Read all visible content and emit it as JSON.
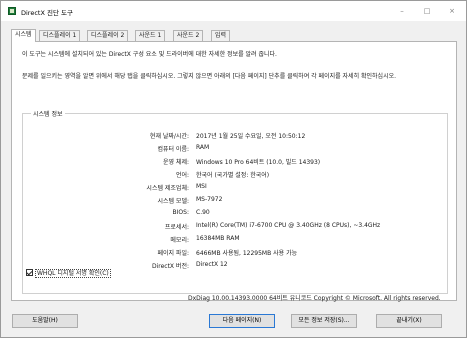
{
  "window": {
    "title": "DirectX 진단 도구",
    "minimize": "–",
    "maximize": "□",
    "close": "×"
  },
  "tabs": [
    "시스템",
    "디스플레이 1",
    "디스플레이 2",
    "사운드 1",
    "사운드 2",
    "입력"
  ],
  "intro": "이 도구는 시스템에 설치되어 있는 DirectX 구성 요소 및 드라이버에 대한 자세한 정보를 알려 줍니다.",
  "note": "문제를 일으키는 영역을 알면 위에서 해당 탭을 클릭하십시오. 그렇지 않으면 아래의 [다음 페이지] 단추를 클릭하여 각 페이지를 자세히 확인하십시오.",
  "system_info": {
    "title": "시스템 정보",
    "rows": [
      {
        "label": "현재 날짜/시간:",
        "value": "2017년 1월 25일 수요일, 오전 10:50:12"
      },
      {
        "label": "컴퓨터 이름:",
        "value": "RAM"
      },
      {
        "label": "운영 체제:",
        "value": "Windows 10 Pro 64비트 (10.0, 빌드 14393)"
      },
      {
        "label": "언어:",
        "value": "한국어 (국가별 설정: 한국어)"
      },
      {
        "label": "시스템 제조업체:",
        "value": "MSI"
      },
      {
        "label": "시스템 모델:",
        "value": "MS-7972"
      },
      {
        "label": "BIOS:",
        "value": "C.90"
      },
      {
        "label": "프로세서:",
        "value": "Intel(R) Core(TM) i7-6700 CPU @ 3.40GHz (8 CPUs), ~3.4GHz"
      },
      {
        "label": "메모리:",
        "value": "16384MB RAM"
      },
      {
        "label": "페이지 파일:",
        "value": "6466MB 사용됨, 12295MB 사용 가능"
      },
      {
        "label": "DirectX 버전:",
        "value": "DirectX 12"
      }
    ]
  },
  "whql_label": "WHQL 디지털 서명 확인(C)",
  "footer": "DxDiag 10.00.14393.0000 64비트 유니코드  Copyright © Microsoft. All rights reserved.",
  "buttons": {
    "help": "도움말(H)",
    "next": "다음 페이지(N)",
    "save": "모든 정보 저장(S)...",
    "exit": "끝내기(X)"
  }
}
